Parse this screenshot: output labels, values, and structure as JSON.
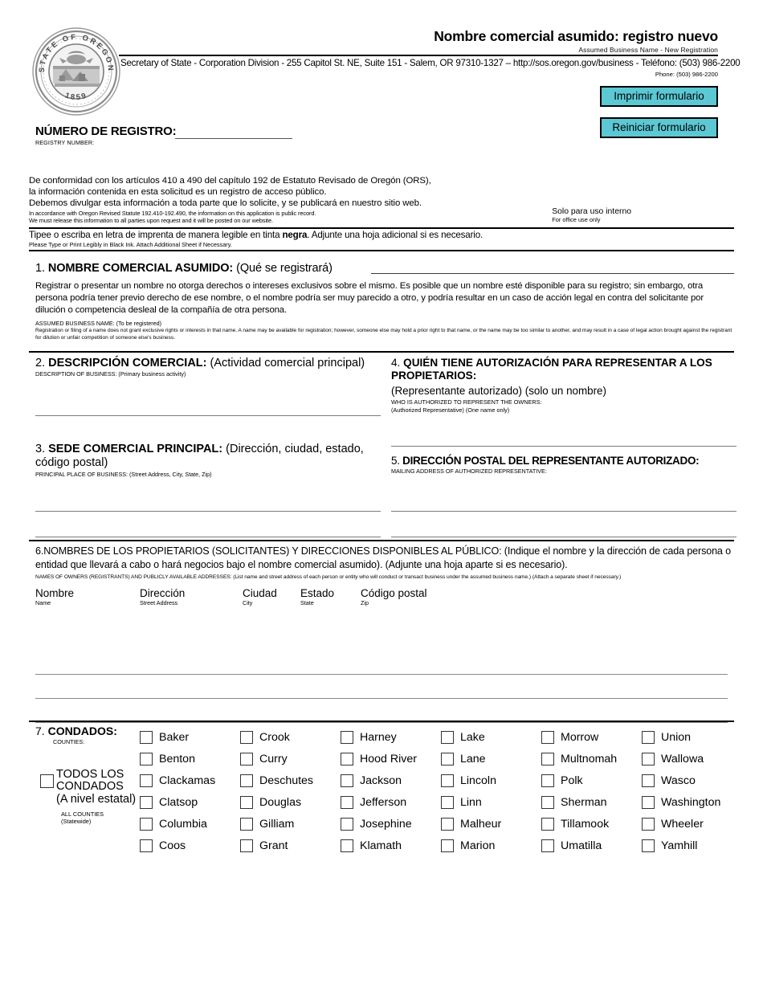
{
  "header": {
    "title_es": "Nombre comercial asumido: registro nuevo",
    "title_en": "Assumed Business Name - New Registration",
    "contact_line": "Secretary of State - Corporation Division - 255 Capitol St. NE, Suite 151 - Salem, OR 97310-1327 – http://sos.oregon.gov/business - Teléfono: (503) 986-2200",
    "phone_en": "Phone: (503) 986-2200",
    "seal": {
      "top_text": "STATE OF OREGON",
      "year": "1859"
    },
    "buttons": {
      "print": "Imprimir formulario",
      "reset": "Reiniciar formulario"
    },
    "accent_color": "#5BC8D4"
  },
  "registry": {
    "label_es": "NÚMERO DE REGISTRO:",
    "label_en": "REGISTRY NUMBER:",
    "value": ""
  },
  "disclosure": {
    "line1": "De conformidad con los artículos 410 a 490 del capítulo 192 de Estatuto Revisado de Oregón (ORS),",
    "line2": "la información contenida en esta solicitud es un registro de acceso público.",
    "line3": "Debemos divulgar esta información a toda parte que lo solicite, y se publicará en nuestro sitio web.",
    "en1": "In accordance with Oregon Revised Statute 192.410-192.490, the information on this application is public record.",
    "en2": "We must release this information to all parties upon request and it will be posted on our website.",
    "office_es": "Solo para uso interno",
    "office_en": "For office use only"
  },
  "typeline": {
    "es_a": "Tipee o escriba en letra de imprenta de manera legible en tinta ",
    "es_bold": "negra",
    "es_b": ". Adjunte una hoja adicional si es necesario.",
    "en": "Please Type or Print Legibly in Black Ink. Attach Additional Sheet if Necessary."
  },
  "section1": {
    "num": "1.",
    "title_es": "NOMBRE COMERCIAL ASUMIDO:",
    "paren_es": " (Qué se registrará)",
    "body_es": "Registrar o presentar un nombre no otorga derechos o intereses exclusivos sobre el mismo. Es posible que un nombre esté disponible para su registro; sin embargo, otra persona podría tener previo derecho de ese nombre, o el nombre podría ser muy parecido a otro, y podría resultar en un caso de acción legal en contra del solicitante por dilución o competencia desleal de la compañía de otra persona.",
    "en_label": "ASSUMED BUSINESS NAME: (To be registered)",
    "en_body": "Registration or filing of a name does not grant exclusive rights or interests in that name. A name may be available for registration; however, someone else may hold a prior right to that  name, or the name may be too similar to another, and may result in a case of legal action brought against the registrant for dilution or unfair competition of someone else's business.",
    "value": ""
  },
  "section2": {
    "num": "2.",
    "title_es": "DESCRIPCIÓN COMERCIAL:",
    "paren_es": " (Actividad comercial principal)",
    "en": "DESCRIPTION OF BUSINESS: (Primary business activity)",
    "value": ""
  },
  "section3": {
    "num": "3.",
    "title_es": "SEDE COMERCIAL PRINCIPAL:",
    "paren_es": " (Dirección, ciudad, estado, código postal)",
    "en": "PRINCIPAL PLACE OF BUSINESS: (Street Address, City, State, Zip)",
    "value": ""
  },
  "section4": {
    "num": "4.",
    "title_es": "QUIÉN TIENE AUTORIZACIÓN PARA REPRESENTAR A LOS PROPIETARIOS:",
    "sub_es": "(Representante autorizado) (solo un nombre)",
    "en1": "WHO IS AUTHORIZED TO REPRESENT THE OWNERS:",
    "en2": "(Authorized Representative) (One name only)",
    "value": ""
  },
  "section5": {
    "num": "5.",
    "title_es": "DIRECCIÓN POSTAL DEL REPRESENTANTE AUTORIZADO:",
    "en": "MAILING ADDRESS OF AUTHORIZED REPRESENTATIVE:",
    "value": ""
  },
  "section6": {
    "num": "6.",
    "head_es": "NOMBRES DE LOS PROPIETARIOS (SOLICITANTES) Y DIRECCIONES DISPONIBLES AL PÚBLICO: (Indique el nombre y la dirección de cada persona o entidad que llevará a cabo o hará negocios bajo el nombre comercial asumido). (Adjunte una hoja aparte si es necesario).",
    "en": "NAMES OF OWNERS (REGISTRANTS) AND PUBLICLY AVAILABLE ADDRESSES: (List name and street address of each person or entity who will conduct or transact business under the assumed business name.) (Attach a separate sheet if necessary.)",
    "columns": [
      {
        "es": "Nombre",
        "en": "Name"
      },
      {
        "es": "Dirección",
        "en": "Street Address"
      },
      {
        "es": "Ciudad",
        "en": "City"
      },
      {
        "es": "Estado",
        "en": "State"
      },
      {
        "es": "Código postal",
        "en": "Zip"
      }
    ],
    "rows": [
      "",
      "",
      ""
    ]
  },
  "section7": {
    "num": "7.",
    "title_es": "CONDADOS:",
    "en": "COUNTIES:",
    "all_counties": {
      "line1": "TODOS LOS",
      "line2": "CONDADOS",
      "line3": "(A nivel estatal)",
      "en1": "ALL COUNTIES",
      "en2": "(Statewide)",
      "checked": false
    },
    "counties": [
      {
        "name": "Baker",
        "checked": false
      },
      {
        "name": "Crook",
        "checked": false
      },
      {
        "name": "Harney",
        "checked": false
      },
      {
        "name": "Lake",
        "checked": false
      },
      {
        "name": "Morrow",
        "checked": false
      },
      {
        "name": "Union",
        "checked": false
      },
      {
        "name": "Benton",
        "checked": false
      },
      {
        "name": "Curry",
        "checked": false
      },
      {
        "name": "Hood River",
        "checked": false
      },
      {
        "name": "Lane",
        "checked": false
      },
      {
        "name": "Multnomah",
        "checked": false
      },
      {
        "name": "Wallowa",
        "checked": false
      },
      {
        "name": "Clackamas",
        "checked": false
      },
      {
        "name": "Deschutes",
        "checked": false
      },
      {
        "name": "Jackson",
        "checked": false
      },
      {
        "name": "Lincoln",
        "checked": false
      },
      {
        "name": "Polk",
        "checked": false
      },
      {
        "name": "Wasco",
        "checked": false
      },
      {
        "name": "Clatsop",
        "checked": false
      },
      {
        "name": "Douglas",
        "checked": false
      },
      {
        "name": "Jefferson",
        "checked": false
      },
      {
        "name": "Linn",
        "checked": false
      },
      {
        "name": "Sherman",
        "checked": false
      },
      {
        "name": "Washington",
        "checked": false
      },
      {
        "name": "Columbia",
        "checked": false
      },
      {
        "name": "Gilliam",
        "checked": false
      },
      {
        "name": "Josephine",
        "checked": false
      },
      {
        "name": "Malheur",
        "checked": false
      },
      {
        "name": "Tillamook",
        "checked": false
      },
      {
        "name": "Wheeler",
        "checked": false
      },
      {
        "name": "Coos",
        "checked": false
      },
      {
        "name": "Grant",
        "checked": false
      },
      {
        "name": "Klamath",
        "checked": false
      },
      {
        "name": "Marion",
        "checked": false
      },
      {
        "name": "Umatilla",
        "checked": false
      },
      {
        "name": "Yamhill",
        "checked": false
      }
    ]
  }
}
